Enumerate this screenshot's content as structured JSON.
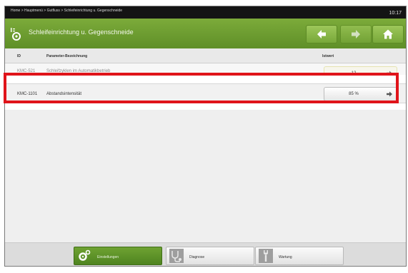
{
  "topbar": {
    "breadcrumb": "Home > Hauptmenü > Gutfluss > Schleifeinrichtung u. Gegenschneide",
    "time": "10:17"
  },
  "header": {
    "title": "Schleifeinrichtung u. Gegenschneide",
    "back_icon": "arrow-left-icon",
    "forward_icon": "arrow-right-icon",
    "home_icon": "home-icon"
  },
  "columns": {
    "id": "ID",
    "param": "Parameter-Bezeichnung",
    "value": "Istwert"
  },
  "rows": [
    {
      "id": "KMC-521",
      "name": "Schleifzyklen im Automatikbetrieb",
      "value": "12"
    },
    {
      "id": "KMC-1101",
      "name": "Abstandsintensität",
      "value": "85 %"
    }
  ],
  "tabs": [
    {
      "label": "Einstellungen",
      "icon": "gears-icon",
      "active": true
    },
    {
      "label": "Diagnose",
      "icon": "stethoscope-icon",
      "active": false
    },
    {
      "label": "Wartung",
      "icon": "wrench-icon",
      "active": false
    }
  ],
  "colors": {
    "accent_green": "#6ea232",
    "highlight_red": "#e0141a"
  }
}
